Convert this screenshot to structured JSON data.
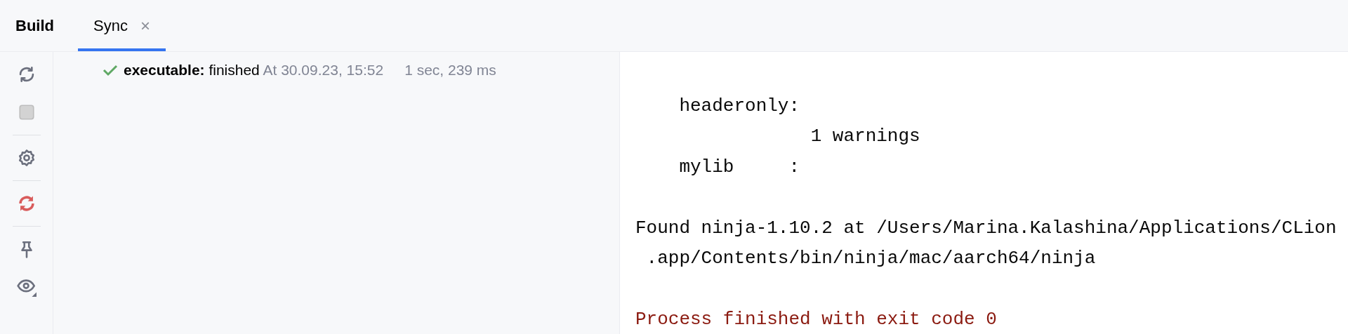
{
  "tabs": [
    {
      "label": "Build",
      "kind": "title",
      "selected": false
    },
    {
      "label": "Sync",
      "kind": "tab",
      "selected": true,
      "close": "×"
    }
  ],
  "toolbar": [
    {
      "kind": "icon",
      "disabled": false
    },
    {
      "kind": "icon",
      "disabled": true
    },
    {
      "kind": "divider"
    },
    {
      "kind": "icon",
      "disabled": false
    },
    {
      "kind": "divider"
    },
    {
      "kind": "icon",
      "disabled": false
    },
    {
      "kind": "divider"
    },
    {
      "kind": "icon",
      "disabled": false
    },
    {
      "kind": "icon",
      "disabled": false
    }
  ],
  "tree": [
    {
      "name": "executable:",
      "message": "finished",
      "time": "At 30.09.23, 15:52",
      "duration": "1 sec, 239 ms"
    }
  ],
  "console": [
    {
      "kind": "blank"
    },
    {
      "kind": "normal",
      "text": "    headeronly:"
    },
    {
      "kind": "normal",
      "text": "                1 warnings"
    },
    {
      "kind": "normal",
      "text": "    mylib     :"
    },
    {
      "kind": "blank"
    },
    {
      "kind": "normal",
      "text": "Found ninja-1.10.2 at /Users/Marina.Kalashina/Applications/CLion"
    },
    {
      "kind": "normal",
      "text": " .app/Contents/bin/ninja/mac/aarch64/ninja"
    },
    {
      "kind": "blank"
    },
    {
      "kind": "error",
      "text": "Process finished with exit code 0"
    }
  ]
}
